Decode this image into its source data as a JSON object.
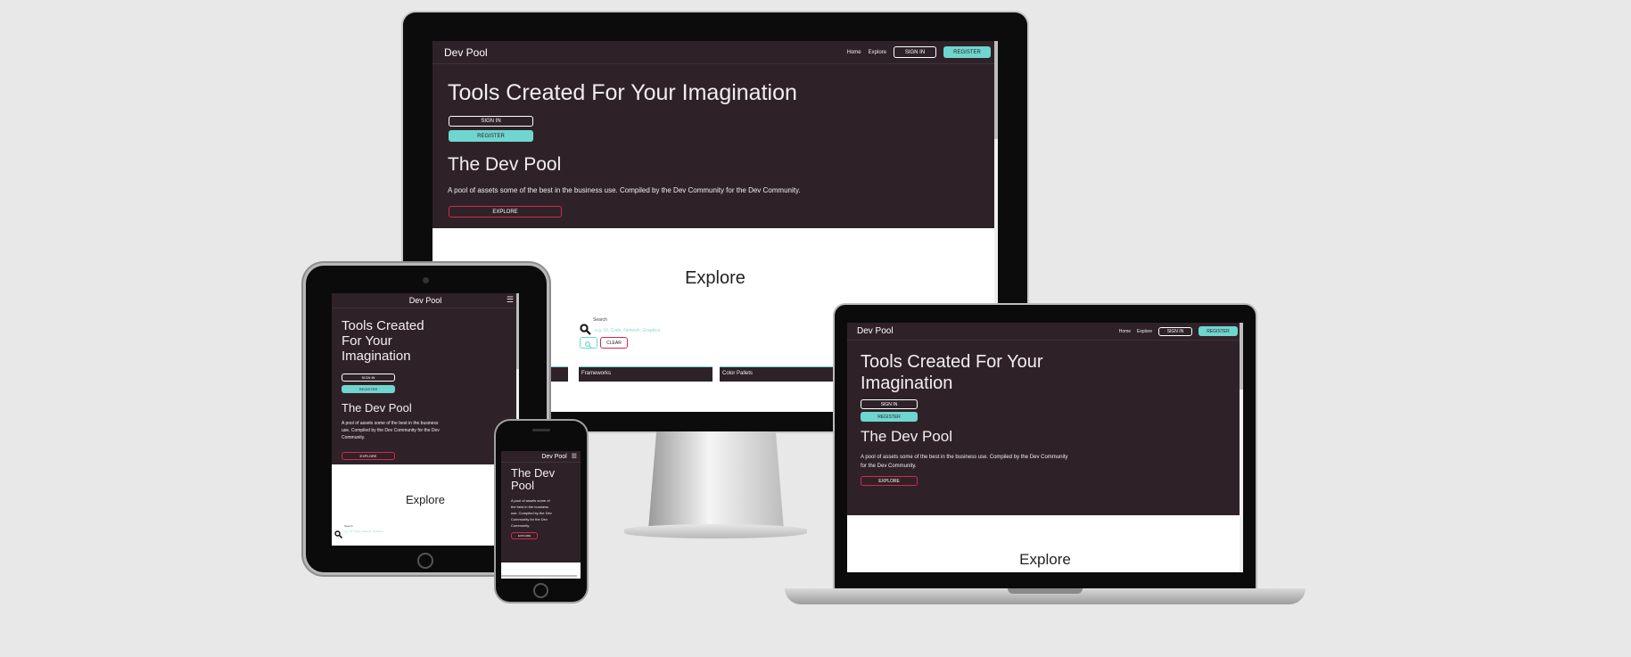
{
  "site": {
    "brand": "Dev Pool",
    "nav": {
      "home": "Home",
      "explore": "Explore",
      "sign_in": "SIGN IN",
      "register": "REGISTER"
    },
    "hero": {
      "title": "Tools Created For Your Imagination",
      "tablet_title_lines": [
        "Tools Created",
        "For Your",
        "Imagination"
      ],
      "laptop_title_lines": [
        "Tools Created For Your",
        "Imagination"
      ],
      "sign_in": "SIGN IN",
      "register": "REGISTER"
    },
    "about": {
      "title": "The Dev Pool",
      "text": "A pool of assets some of the best in the business use. Compiled by the Dev Community for the Dev Community.",
      "tablet_lines": [
        "A pool of assets some of the best in the business",
        "use. Compiled by the Dev Community for the Dev",
        "Community."
      ],
      "phone_lines": [
        "A pool of assets some of",
        "the best in the business",
        "use. Compiled by the Dev",
        "Community for the Dev",
        "Community."
      ],
      "laptop_lines": [
        "A pool of assets some of the best in the business use. Compiled by the Dev Community",
        "for the Dev Community."
      ],
      "explore_btn": "EXPLORE"
    },
    "explore": {
      "title": "Explore",
      "search_label": "Search",
      "search_placeholder": "e.g. UI, Code, Network, Graphics",
      "clear": "CLEAR",
      "categories": [
        "Frameworks",
        "Color Pallets"
      ]
    }
  },
  "colors": {
    "dark_bg": "#2e2228",
    "accent_teal": "#6fd6cf",
    "accent_red": "#d2294e"
  },
  "icons": [
    "search-icon",
    "hamburger-menu-icon"
  ]
}
